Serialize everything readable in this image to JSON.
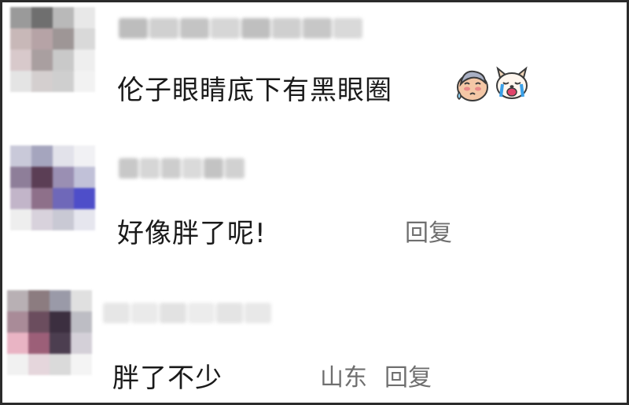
{
  "comments": [
    {
      "text": "伦子眼睛底下有黑眼圈",
      "emojis": [
        "crying-sweat-face-icon",
        "crying-dog-icon"
      ],
      "avatar_colors": [
        "#9a9a9a",
        "#6f6f6f",
        "#b9b9b9",
        "#e8e8e8",
        "#c8b8b8",
        "#b6a3a6",
        "#9e9696",
        "#d9d9d9",
        "#d8c9cb",
        "#a99fa0",
        "#c9c9c9",
        "#eeeeee",
        "#e4e4e4",
        "#d4cfcf",
        "#cfcfcf",
        "#f2f2f2"
      ],
      "name_colors": [
        "#bdbdbd",
        "#d0d0d0",
        "#c4c4c4",
        "#d6d6d6",
        "#bfbfbf",
        "#cfcfcf",
        "#c7c7c7",
        "#d9d9d9"
      ]
    },
    {
      "text": "好像胖了呢!",
      "reply_label": "回复",
      "avatar_colors": [
        "#c9c9d9",
        "#a5a5be",
        "#e2e2ea",
        "#f1f1f4",
        "#8e7e99",
        "#5b3e55",
        "#9a8fb3",
        "#c1c1d8",
        "#c2b5c9",
        "#8e708a",
        "#6f68b9",
        "#4e4ec9",
        "#eeeeee",
        "#d8d2dc",
        "#c9c9d4",
        "#e6e6ee"
      ],
      "name_colors": [
        "#c8c8c8",
        "#d6d6d6",
        "#cdcdcd",
        "#dadada",
        "#c3c3c3",
        "#d1d1d1"
      ]
    },
    {
      "text": "胖了不少",
      "location": "山东",
      "reply_label": "回复",
      "avatar_colors": [
        "#b8b0b4",
        "#8c7c80",
        "#9a9aa8",
        "#e0e0e0",
        "#a98b98",
        "#6b4d5e",
        "#3c2f40",
        "#bdbdc4",
        "#e9b4c4",
        "#9c5f78",
        "#4c3e50",
        "#d4d0d8",
        "#f1f1f1",
        "#e5d6dc",
        "#dadada",
        "#f4f4f4"
      ],
      "name_colors": [
        "#e6e6e6",
        "#eaeaea",
        "#e2e2e2",
        "#ececec",
        "#e4e4e4",
        "#e8e8e8"
      ]
    }
  ]
}
